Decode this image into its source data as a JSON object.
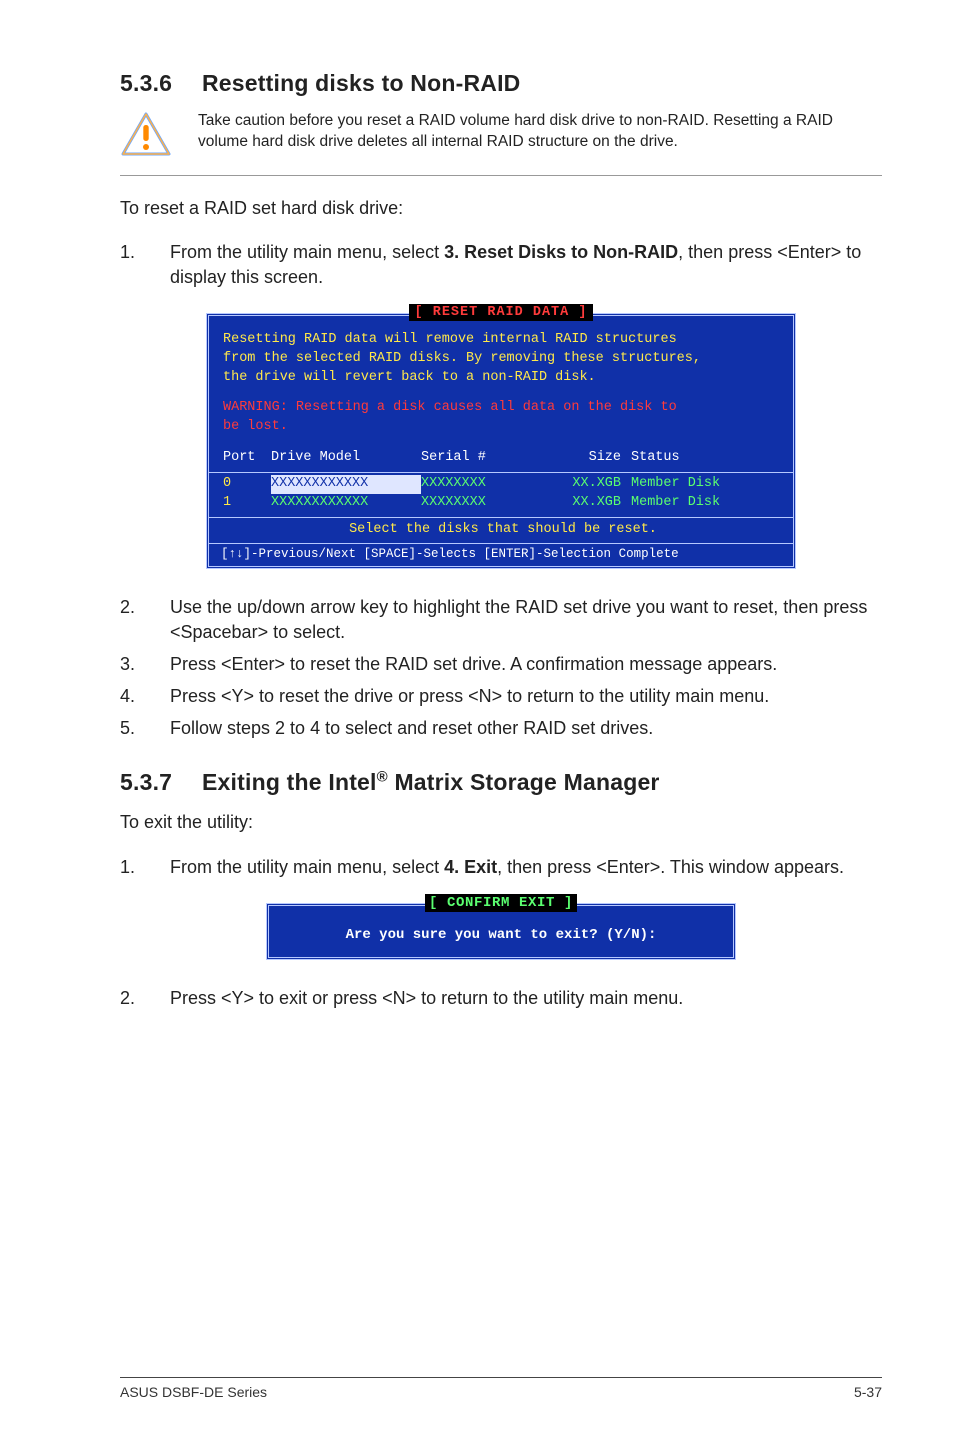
{
  "section1": {
    "num": "5.3.6",
    "title": "Resetting disks to Non-RAID",
    "caution": "Take caution before you reset a RAID volume hard disk drive to non-RAID. Resetting a RAID volume hard disk drive deletes all internal RAID structure on the drive.",
    "intro": "To reset a RAID set hard disk drive:",
    "step1_num": "1.",
    "step1_pre": "From the utility main menu, select ",
    "step1_bold": "3. Reset Disks to Non-RAID",
    "step1_post": ", then press <Enter> to display this screen.",
    "step2_num": "2.",
    "step2": "Use the up/down arrow key to highlight the RAID set drive you want to reset, then press <Spacebar> to select.",
    "step3_num": "3.",
    "step3": "Press <Enter> to reset the RAID set drive. A confirmation message appears.",
    "step4_num": "4.",
    "step4": "Press <Y> to reset the drive or press <N> to return to the utility main menu.",
    "step5_num": "5.",
    "step5": "Follow steps 2 to 4 to select and reset other RAID set drives."
  },
  "term1": {
    "title": "[ RESET RAID DATA ]",
    "para1a": "Resetting RAID data will remove internal RAID structures",
    "para1b": "from the selected RAID disks. By removing these structures,",
    "para1c": "the drive will revert back to a non-RAID disk.",
    "warn1": "WARNING: Resetting a disk causes all data on the disk to",
    "warn2": "be lost.",
    "hdr_port": "Port",
    "hdr_model": "Drive Model",
    "hdr_serial": "Serial #",
    "hdr_size": "Size",
    "hdr_status": "Status",
    "r0_port": "0",
    "r0_model": "XXXXXXXXXXXX",
    "r0_serial": "XXXXXXXX",
    "r0_size": "XX.XGB",
    "r0_status": "Member Disk",
    "r1_port": "1",
    "r1_model": "XXXXXXXXXXXX",
    "r1_serial": "XXXXXXXX",
    "r1_size": "XX.XGB",
    "r1_status": "Member Disk",
    "select_msg": "Select the disks that should be reset.",
    "footer": "[↑↓]-Previous/Next  [SPACE]-Selects  [ENTER]-Selection Complete"
  },
  "section2": {
    "num": "5.3.7",
    "title_pre": "Exiting the Intel",
    "title_sup": "®",
    "title_post": " Matrix Storage Manager",
    "intro": "To exit the utility:",
    "step1_num": "1.",
    "step1_pre": "From the utility main menu, select ",
    "step1_bold": "4. Exit",
    "step1_post": ", then press <Enter>. This window appears.",
    "step2_num": "2.",
    "step2": "Press <Y> to exit or press <N> to return to the utility main menu."
  },
  "term2": {
    "title": "[ CONFIRM EXIT ]",
    "body": "Are you sure you want to exit? (Y/N):"
  },
  "footer": {
    "left": "ASUS DSBF-DE Series",
    "right": "5-37"
  }
}
